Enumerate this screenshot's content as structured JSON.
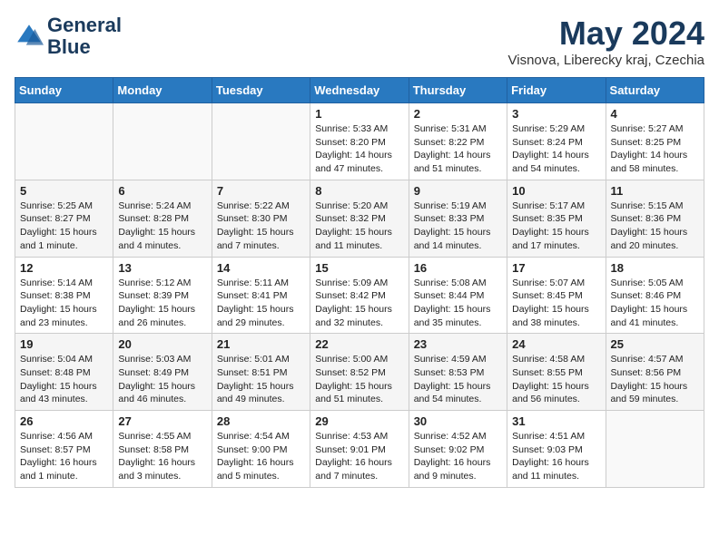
{
  "header": {
    "logo_line1": "General",
    "logo_line2": "Blue",
    "month": "May 2024",
    "location": "Visnova, Liberecky kraj, Czechia"
  },
  "weekdays": [
    "Sunday",
    "Monday",
    "Tuesday",
    "Wednesday",
    "Thursday",
    "Friday",
    "Saturday"
  ],
  "weeks": [
    [
      {
        "day": "",
        "info": ""
      },
      {
        "day": "",
        "info": ""
      },
      {
        "day": "",
        "info": ""
      },
      {
        "day": "1",
        "info": "Sunrise: 5:33 AM\nSunset: 8:20 PM\nDaylight: 14 hours\nand 47 minutes."
      },
      {
        "day": "2",
        "info": "Sunrise: 5:31 AM\nSunset: 8:22 PM\nDaylight: 14 hours\nand 51 minutes."
      },
      {
        "day": "3",
        "info": "Sunrise: 5:29 AM\nSunset: 8:24 PM\nDaylight: 14 hours\nand 54 minutes."
      },
      {
        "day": "4",
        "info": "Sunrise: 5:27 AM\nSunset: 8:25 PM\nDaylight: 14 hours\nand 58 minutes."
      }
    ],
    [
      {
        "day": "5",
        "info": "Sunrise: 5:25 AM\nSunset: 8:27 PM\nDaylight: 15 hours\nand 1 minute."
      },
      {
        "day": "6",
        "info": "Sunrise: 5:24 AM\nSunset: 8:28 PM\nDaylight: 15 hours\nand 4 minutes."
      },
      {
        "day": "7",
        "info": "Sunrise: 5:22 AM\nSunset: 8:30 PM\nDaylight: 15 hours\nand 7 minutes."
      },
      {
        "day": "8",
        "info": "Sunrise: 5:20 AM\nSunset: 8:32 PM\nDaylight: 15 hours\nand 11 minutes."
      },
      {
        "day": "9",
        "info": "Sunrise: 5:19 AM\nSunset: 8:33 PM\nDaylight: 15 hours\nand 14 minutes."
      },
      {
        "day": "10",
        "info": "Sunrise: 5:17 AM\nSunset: 8:35 PM\nDaylight: 15 hours\nand 17 minutes."
      },
      {
        "day": "11",
        "info": "Sunrise: 5:15 AM\nSunset: 8:36 PM\nDaylight: 15 hours\nand 20 minutes."
      }
    ],
    [
      {
        "day": "12",
        "info": "Sunrise: 5:14 AM\nSunset: 8:38 PM\nDaylight: 15 hours\nand 23 minutes."
      },
      {
        "day": "13",
        "info": "Sunrise: 5:12 AM\nSunset: 8:39 PM\nDaylight: 15 hours\nand 26 minutes."
      },
      {
        "day": "14",
        "info": "Sunrise: 5:11 AM\nSunset: 8:41 PM\nDaylight: 15 hours\nand 29 minutes."
      },
      {
        "day": "15",
        "info": "Sunrise: 5:09 AM\nSunset: 8:42 PM\nDaylight: 15 hours\nand 32 minutes."
      },
      {
        "day": "16",
        "info": "Sunrise: 5:08 AM\nSunset: 8:44 PM\nDaylight: 15 hours\nand 35 minutes."
      },
      {
        "day": "17",
        "info": "Sunrise: 5:07 AM\nSunset: 8:45 PM\nDaylight: 15 hours\nand 38 minutes."
      },
      {
        "day": "18",
        "info": "Sunrise: 5:05 AM\nSunset: 8:46 PM\nDaylight: 15 hours\nand 41 minutes."
      }
    ],
    [
      {
        "day": "19",
        "info": "Sunrise: 5:04 AM\nSunset: 8:48 PM\nDaylight: 15 hours\nand 43 minutes."
      },
      {
        "day": "20",
        "info": "Sunrise: 5:03 AM\nSunset: 8:49 PM\nDaylight: 15 hours\nand 46 minutes."
      },
      {
        "day": "21",
        "info": "Sunrise: 5:01 AM\nSunset: 8:51 PM\nDaylight: 15 hours\nand 49 minutes."
      },
      {
        "day": "22",
        "info": "Sunrise: 5:00 AM\nSunset: 8:52 PM\nDaylight: 15 hours\nand 51 minutes."
      },
      {
        "day": "23",
        "info": "Sunrise: 4:59 AM\nSunset: 8:53 PM\nDaylight: 15 hours\nand 54 minutes."
      },
      {
        "day": "24",
        "info": "Sunrise: 4:58 AM\nSunset: 8:55 PM\nDaylight: 15 hours\nand 56 minutes."
      },
      {
        "day": "25",
        "info": "Sunrise: 4:57 AM\nSunset: 8:56 PM\nDaylight: 15 hours\nand 59 minutes."
      }
    ],
    [
      {
        "day": "26",
        "info": "Sunrise: 4:56 AM\nSunset: 8:57 PM\nDaylight: 16 hours\nand 1 minute."
      },
      {
        "day": "27",
        "info": "Sunrise: 4:55 AM\nSunset: 8:58 PM\nDaylight: 16 hours\nand 3 minutes."
      },
      {
        "day": "28",
        "info": "Sunrise: 4:54 AM\nSunset: 9:00 PM\nDaylight: 16 hours\nand 5 minutes."
      },
      {
        "day": "29",
        "info": "Sunrise: 4:53 AM\nSunset: 9:01 PM\nDaylight: 16 hours\nand 7 minutes."
      },
      {
        "day": "30",
        "info": "Sunrise: 4:52 AM\nSunset: 9:02 PM\nDaylight: 16 hours\nand 9 minutes."
      },
      {
        "day": "31",
        "info": "Sunrise: 4:51 AM\nSunset: 9:03 PM\nDaylight: 16 hours\nand 11 minutes."
      },
      {
        "day": "",
        "info": ""
      }
    ]
  ]
}
